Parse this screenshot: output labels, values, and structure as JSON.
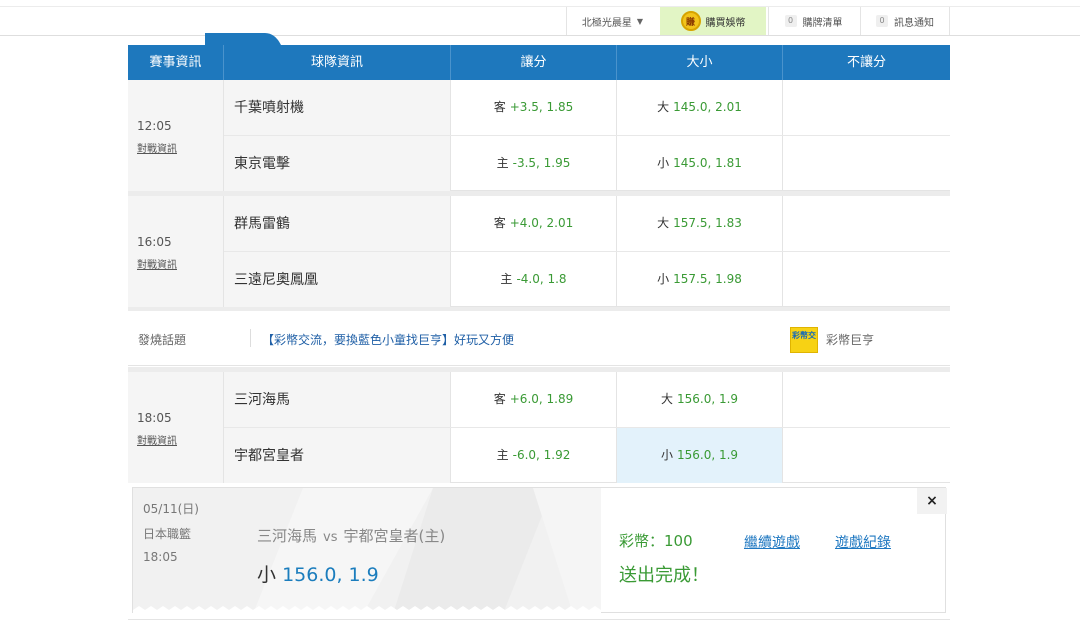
{
  "topbar": {
    "user": "北極光晨星",
    "buy": "購買娛幣",
    "buy_icon_text": "賺",
    "cart_count": "0",
    "cart": "購牌清單",
    "msg_count": "0",
    "msg": "訊息通知"
  },
  "table": {
    "headers": [
      "賽事資訊",
      "球隊資訊",
      "讓分",
      "大小",
      "不讓分"
    ]
  },
  "games": [
    {
      "time": "12:05",
      "link": "對戰資訊",
      "away": "千葉噴射機",
      "home": "東京電擊",
      "spread_away_label": "客",
      "spread_away": "+3.5, 1.85",
      "spread_home_label": "主",
      "spread_home": "-3.5, 1.95",
      "total_over_label": "大",
      "total_over": "145.0, 2.01",
      "total_under_label": "小",
      "total_under": "145.0, 1.81"
    },
    {
      "time": "16:05",
      "link": "對戰資訊",
      "away": "群馬雷鶴",
      "home": "三遠尼奧鳳凰",
      "spread_away_label": "客",
      "spread_away": "+4.0, 2.01",
      "spread_home_label": "主",
      "spread_home": "-4.0, 1.8",
      "total_over_label": "大",
      "total_over": "157.5, 1.83",
      "total_under_label": "小",
      "total_under": "157.5, 1.98"
    },
    {
      "time": "18:05",
      "link": "對戰資訊",
      "away": "三河海馬",
      "home": "宇都宮皇者",
      "spread_away_label": "客",
      "spread_away": "+6.0, 1.89",
      "spread_home_label": "主",
      "spread_home": "-6.0, 1.92",
      "total_over_label": "大",
      "total_over": "156.0, 1.9",
      "total_under_label": "小",
      "total_under": "156.0, 1.9"
    }
  ],
  "hot": {
    "label": "發燒話題",
    "link": "【彩幣交流，要換藍色小童找巨亨】好玩又方便",
    "logo_text": "彩幣交",
    "name": "彩幣巨亨"
  },
  "slip": {
    "date": "05/11(日)",
    "league": "日本職籃",
    "time": "18:05",
    "away": "三河海馬",
    "vs": "vs",
    "home": "宇都宮皇者(主)",
    "pick_label": "小",
    "pick_value": "156.0, 1.9",
    "coins": "彩幣：100",
    "done": "送出完成！",
    "continue": "繼續遊戲",
    "records": "遊戲紀錄",
    "close": "×"
  }
}
